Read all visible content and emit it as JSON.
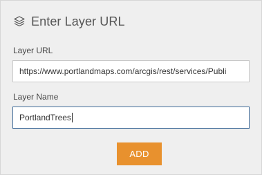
{
  "panel": {
    "title": "Enter Layer URL",
    "icon": "layers-icon"
  },
  "layer_url": {
    "label": "Layer URL",
    "value": "https://www.portlandmaps.com/arcgis/rest/services/Publi"
  },
  "layer_name": {
    "label": "Layer Name",
    "value": "PortlandTrees"
  },
  "actions": {
    "add_label": "ADD"
  },
  "colors": {
    "accent": "#e8912e",
    "focus_border": "#3e6a98",
    "panel_bg": "#efefef"
  }
}
